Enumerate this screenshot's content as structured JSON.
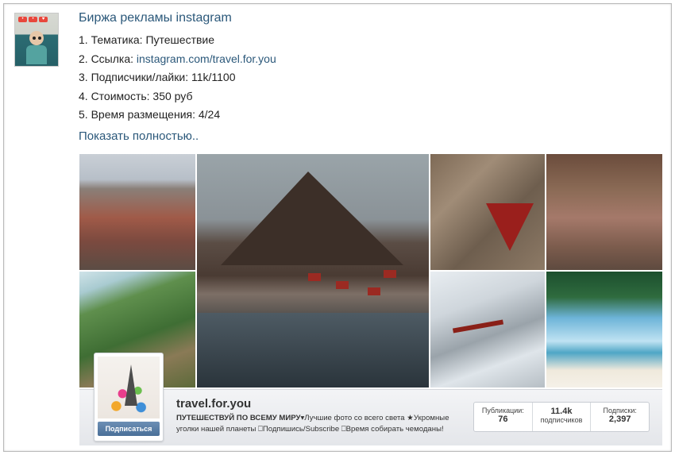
{
  "post": {
    "title": "Биржа рекламы instagram",
    "line1": "1. Тематика: Путешествие",
    "line2_prefix": "2. Ссылка: ",
    "line2_link": "instagram.com/travel.for.you",
    "line3": "3. Подписчики/лайки: 11k/1100",
    "line4": "4. Стоимость: 350 руб",
    "line5": "5. Время размещения: 4/24",
    "expand_link": "Показать полностью.."
  },
  "profile": {
    "username": "travel.for.you",
    "bio_bold": "ПУТЕШЕСТВУЙ ПО ВСЕМУ МИРУ",
    "bio_rest": "▾Лучшие фото со всего света ★Укромные уголки нашей планеты ⎕Подпишись/Subscribe ⎕Время собирать чемоданы!",
    "follow_button": "Подписаться",
    "stats": [
      {
        "label": "Публикации:",
        "value": "76"
      },
      {
        "label": "подписчиков",
        "value": "11.4k"
      },
      {
        "label": "Подписки:",
        "value": "2,397"
      }
    ]
  },
  "avatar_badges": [
    "•",
    "•",
    "♥",
    "•"
  ],
  "colors": {
    "link": "#2b587a",
    "follow_button": "#4a6f98"
  }
}
